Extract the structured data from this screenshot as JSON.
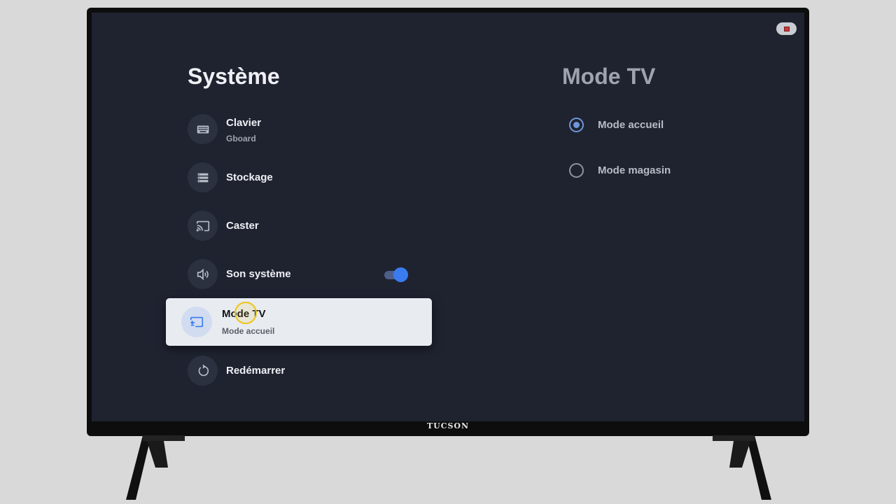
{
  "tv": {
    "brand": "TUCSON"
  },
  "left_panel": {
    "title": "Système",
    "items": [
      {
        "label": "Clavier",
        "subtitle": "Gboard",
        "icon": "keyboard-icon"
      },
      {
        "label": "Stockage",
        "icon": "storage-icon"
      },
      {
        "label": "Caster",
        "icon": "cast-icon"
      },
      {
        "label": "Son système",
        "icon": "volume-icon",
        "toggle_on": true
      },
      {
        "label": "Mode TV",
        "subtitle": "Mode accueil",
        "icon": "tv-mode-icon",
        "selected": true
      },
      {
        "label": "Redémarrer",
        "icon": "restart-icon"
      }
    ]
  },
  "right_panel": {
    "title": "Mode TV",
    "options": [
      {
        "label": "Mode accueil",
        "checked": true
      },
      {
        "label": "Mode magasin",
        "checked": false
      }
    ]
  },
  "colors": {
    "screen_bg": "#1f2330",
    "accent": "#3a7cf0",
    "selected_card_bg": "#e8ebf0",
    "cursor_highlight": "#f0c419"
  }
}
